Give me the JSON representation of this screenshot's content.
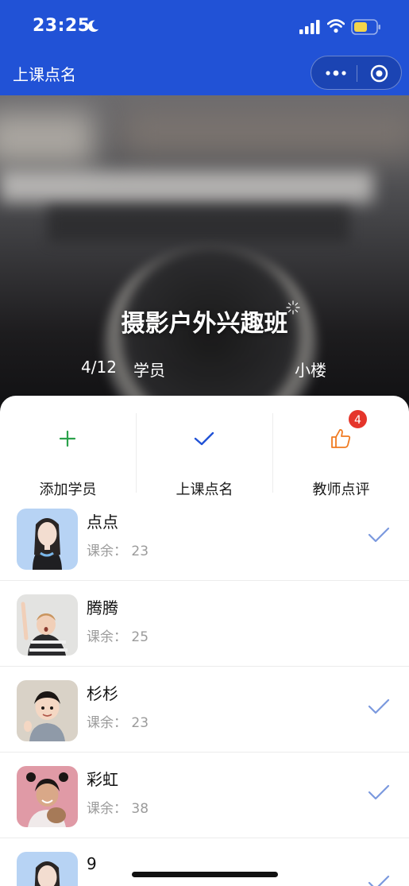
{
  "status_bar": {
    "time": "23:25"
  },
  "nav": {
    "title": "上课点名"
  },
  "hero": {
    "class_name": "摄影户外兴趣班",
    "student_count": "4/12",
    "students_label": "学员",
    "teacher": "小楼"
  },
  "actions": [
    {
      "label": "添加学员",
      "icon": "plus-icon",
      "color": "#2ba14b"
    },
    {
      "label": "上课点名",
      "icon": "check-icon",
      "color": "#2152d6"
    },
    {
      "label": "教师点评",
      "icon": "thumbs-up-icon",
      "color": "#f07b22",
      "badge": "4"
    }
  ],
  "students": [
    {
      "name": "点点",
      "remaining_label": "课余：",
      "remaining": "23",
      "checked": true
    },
    {
      "name": "腾腾",
      "remaining_label": "课余：",
      "remaining": "25",
      "checked": false
    },
    {
      "name": "杉杉",
      "remaining_label": "课余：",
      "remaining": "23",
      "checked": true
    },
    {
      "name": "彩虹",
      "remaining_label": "课余：",
      "remaining": "38",
      "checked": true
    },
    {
      "name": "9",
      "remaining_label": "",
      "remaining": "",
      "checked": true
    }
  ],
  "colors": {
    "nav_bg": "#2152d6",
    "check": "#7b99de",
    "badge": "#e5352b"
  }
}
